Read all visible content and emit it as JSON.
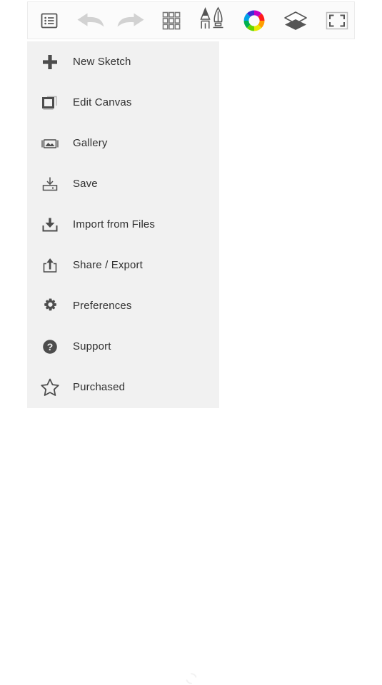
{
  "app": {
    "background_color": "#ffffff",
    "panel_color": "#f1f1f1",
    "toolbar_color": "#fbfbfb",
    "text_color": "#303030",
    "icon_color": "#555555",
    "disabled_icon_color": "#cccccc"
  },
  "toolbar": {
    "name": "top-toolbar",
    "buttons": [
      {
        "icon": "list-menu-icon",
        "label": "Menu",
        "state": "active",
        "color": "#555555"
      },
      {
        "icon": "undo-arrow-icon",
        "label": "Undo",
        "state": "disabled",
        "color": "#d2d2d2"
      },
      {
        "icon": "redo-arrow-icon",
        "label": "Redo",
        "state": "disabled",
        "color": "#d2d2d2"
      },
      {
        "icon": "grid-icon",
        "label": "Grid",
        "state": "active",
        "color": "#777777"
      },
      {
        "icon": "brush-pen-icon",
        "label": "Brushes",
        "state": "active",
        "color": "#555555"
      },
      {
        "icon": "color-wheel-icon",
        "label": "Color",
        "state": "active",
        "color": "rainbow"
      },
      {
        "icon": "layers-icon",
        "label": "Layers",
        "state": "active",
        "color": "#555555"
      },
      {
        "icon": "fullscreen-icon",
        "label": "Full Screen",
        "state": "active",
        "color": "#777777"
      }
    ]
  },
  "menu": {
    "name": "main-dropdown-menu",
    "items": [
      {
        "icon": "plus-icon",
        "label": "New Sketch"
      },
      {
        "icon": "edit-canvas-icon",
        "label": "Edit Canvas"
      },
      {
        "icon": "gallery-image-icon",
        "label": "Gallery"
      },
      {
        "icon": "save-tray-icon",
        "label": "Save"
      },
      {
        "icon": "download-icon",
        "label": "Import from Files"
      },
      {
        "icon": "share-export-icon",
        "label": "Share / Export"
      },
      {
        "icon": "gear-icon",
        "label": "Preferences"
      },
      {
        "icon": "question-circle-icon",
        "label": "Support"
      },
      {
        "icon": "star-outline-icon",
        "label": "Purchased"
      }
    ]
  },
  "canvas": {
    "name": "drawing-canvas",
    "spinner_icon": "loading-spinner-icon"
  }
}
